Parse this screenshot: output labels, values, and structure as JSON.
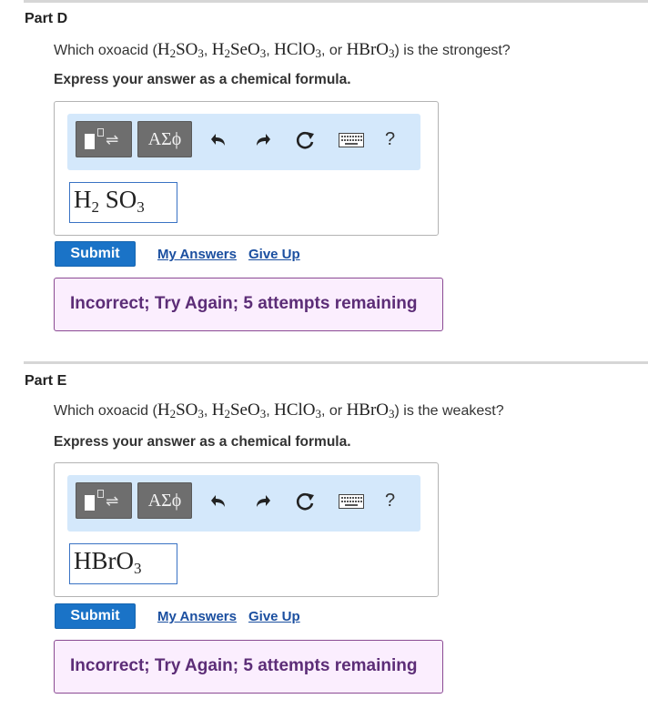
{
  "parts": [
    {
      "title": "Part D",
      "question": {
        "prefix": "Which oxoacid (",
        "formulas": [
          "H2SO3",
          "H2SeO3",
          "HClO3",
          "HBrO3"
        ],
        "sep1": ", ",
        "sep2": ", ",
        "sep3": ", or ",
        "suffix": ") is the strongest?"
      },
      "instruction": "Express your answer as a chemical formula.",
      "toolbar": {
        "symbols_label": "ΑΣϕ",
        "help_label": "?"
      },
      "answer": {
        "parts": [
          "H",
          "2",
          " SO",
          "3"
        ]
      },
      "submit_label": "Submit",
      "my_answers_label": "My Answers",
      "give_up_label": "Give Up",
      "feedback": "Incorrect; Try Again; 5 attempts remaining"
    },
    {
      "title": "Part E",
      "question": {
        "prefix": "Which oxoacid (",
        "formulas": [
          "H2SO3",
          "H2SeO3",
          "HClO3",
          "HBrO3"
        ],
        "sep1": ", ",
        "sep2": ", ",
        "sep3": ", or ",
        "suffix": ") is the weakest?"
      },
      "instruction": "Express your answer as a chemical formula.",
      "toolbar": {
        "symbols_label": "ΑΣϕ",
        "help_label": "?"
      },
      "answer": {
        "parts": [
          "HBrO",
          "3",
          "",
          ""
        ]
      },
      "submit_label": "Submit",
      "my_answers_label": "My Answers",
      "give_up_label": "Give Up",
      "feedback": "Incorrect; Try Again; 5 attempts remaining"
    }
  ],
  "colors": {
    "toolbar_bg": "#d4e8fb",
    "submit_bg": "#1a73c7",
    "feedback_bg": "#fbeefe",
    "feedback_border": "#8a4a93",
    "feedback_text": "#5c2d77",
    "link": "#1b4fa0"
  },
  "icons": [
    "templates-icon",
    "undo-icon",
    "redo-icon",
    "reset-icon",
    "keyboard-icon",
    "help-icon"
  ]
}
